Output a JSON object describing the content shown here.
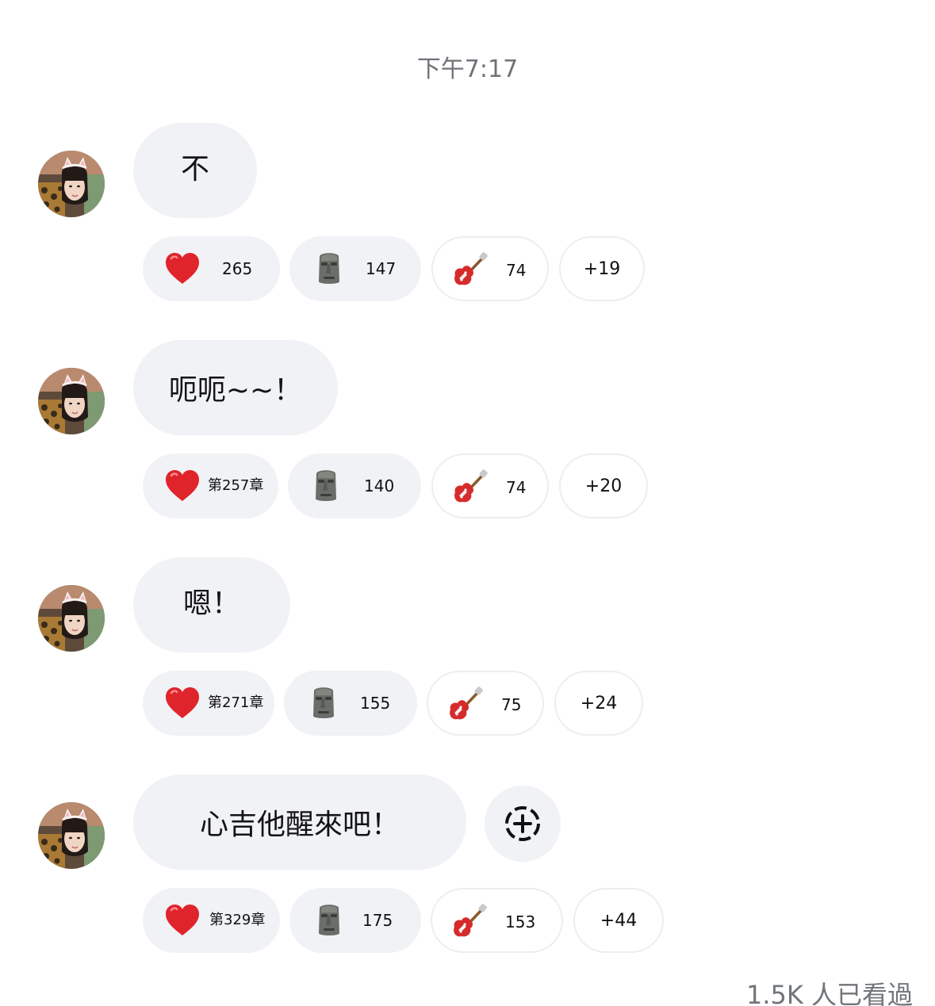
{
  "chat": {
    "timestamp": "下午7:17",
    "messages": [
      {
        "text": "不",
        "reactions": {
          "heart": "265",
          "moai": "147",
          "guitar": "74",
          "more": "+19"
        }
      },
      {
        "text": "呃呃~~！",
        "reactions": {
          "heart": "第257章",
          "moai": "140",
          "guitar": "74",
          "more": "+20"
        }
      },
      {
        "text": "嗯！",
        "reactions": {
          "heart": "第271章",
          "moai": "155",
          "guitar": "75",
          "more": "+24"
        }
      },
      {
        "text": "心吉他醒來吧！",
        "reactions": {
          "heart": "第329章",
          "moai": "175",
          "guitar": "153",
          "more": "+44"
        }
      }
    ],
    "seen_count": "1.5K 人已看過"
  },
  "icons": {
    "reaction_1": "red-heart-emoji",
    "reaction_2": "moai-emoji",
    "reaction_3": "guitar-emoji",
    "add_reaction": "add-reaction-icon"
  },
  "colors": {
    "bubble_bg": "#f0f2f5",
    "text": "#141414",
    "muted_text": "#6f7378",
    "heart": "#e0242c",
    "guitar": "#d62b2b"
  }
}
